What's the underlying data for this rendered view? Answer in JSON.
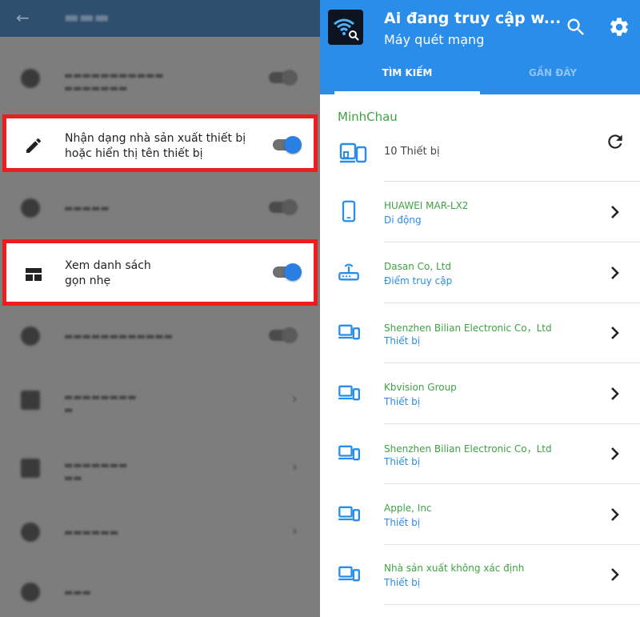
{
  "left_panel": {
    "highlighted_settings": [
      {
        "line1": "Nhận dạng nhà sản xuất thiết bị",
        "line2": "hoặc hiển thị tên thiết bị",
        "icon": "pencil-icon",
        "toggle_on": true
      },
      {
        "line1": "Xem danh sách",
        "line2": "gọn nhẹ",
        "icon": "compact-list-icon",
        "toggle_on": true
      }
    ]
  },
  "app": {
    "title": "Ai đang truy cập w...",
    "subtitle": "Máy quét mạng",
    "tabs": [
      {
        "label": "TÌM KIẾM",
        "active": true
      },
      {
        "label": "GẦN ĐÂY",
        "active": false
      }
    ],
    "network_name": "MinhChau",
    "device_count": "10 Thiết bị",
    "devices": [
      {
        "name": "HUAWEI MAR-LX2",
        "type": "Di động",
        "icon": "smartphone-icon"
      },
      {
        "name": "Dasan Co, Ltd",
        "type": "Điểm truy cập",
        "icon": "router-icon"
      },
      {
        "name": "Shenzhen Bilian Electronic Co，Ltd",
        "type": "Thiết bị",
        "icon": "devices-icon"
      },
      {
        "name": "Kbvision Group",
        "type": "Thiết bị",
        "icon": "devices-icon"
      },
      {
        "name": "Shenzhen Bilian Electronic Co，Ltd",
        "type": "Thiết bị",
        "icon": "devices-icon"
      },
      {
        "name": "Apple, Inc",
        "type": "Thiết bị",
        "icon": "devices-icon"
      },
      {
        "name": "Nhà sản xuất không xác định",
        "type": "Thiết bị",
        "icon": "devices-icon"
      }
    ]
  },
  "colors": {
    "app_bar": "#2a8de9",
    "highlight_border": "#ee1c1c",
    "vendor_green": "#3fa244",
    "type_blue": "#2a8de9",
    "toggle_on": "#2a7fe3"
  }
}
